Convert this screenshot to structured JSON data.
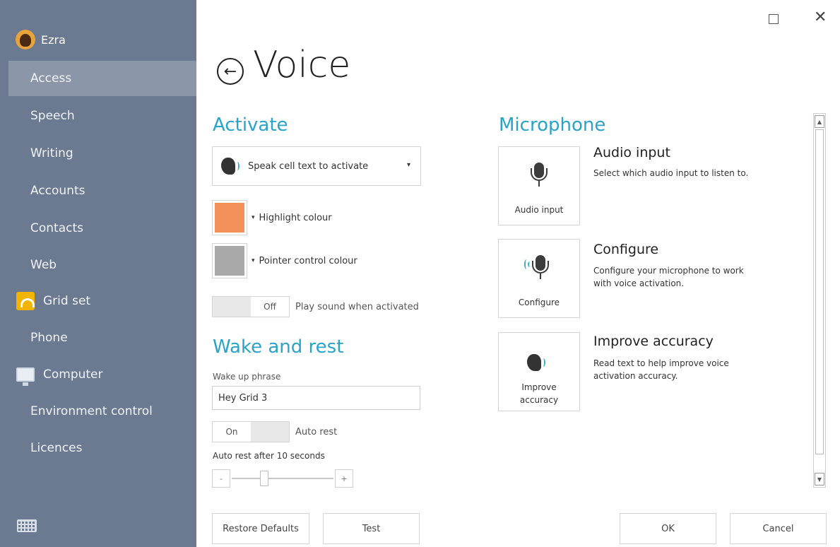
{
  "sidebar": {
    "user_name": "Ezra",
    "items": [
      {
        "label": "Access"
      },
      {
        "label": "Speech"
      },
      {
        "label": "Writing"
      },
      {
        "label": "Accounts"
      },
      {
        "label": "Contacts"
      },
      {
        "label": "Web"
      },
      {
        "label": "Grid set"
      },
      {
        "label": "Phone"
      },
      {
        "label": "Computer"
      },
      {
        "label": "Environment control"
      },
      {
        "label": "Licences"
      }
    ]
  },
  "header": {
    "title": "Voice"
  },
  "activate": {
    "title": "Activate",
    "dropdown_value": "Speak cell text to activate",
    "highlight_label": "Highlight colour",
    "highlight_color": "#f4915a",
    "pointer_label": "Pointer control colour",
    "pointer_color": "#a9a9a9",
    "sound_toggle_state": "Off",
    "sound_toggle_label": "Play sound when activated"
  },
  "wake": {
    "title": "Wake and rest",
    "phrase_label": "Wake up phrase",
    "phrase_value": "Hey Grid 3",
    "auto_rest_state": "On",
    "auto_rest_label": "Auto rest",
    "auto_rest_after_label": "Auto rest after 10 seconds",
    "slider_minus": "-",
    "slider_plus": "+"
  },
  "microphone": {
    "title": "Microphone",
    "options": [
      {
        "tile_label": "Audio input",
        "title": "Audio input",
        "desc": "Select which audio input to listen to."
      },
      {
        "tile_label": "Configure",
        "title": "Configure",
        "desc": "Configure your microphone to work with voice activation."
      },
      {
        "tile_label": "Improve accuracy",
        "title": "Improve accuracy",
        "desc": "Read text to help improve voice activation accuracy."
      }
    ]
  },
  "footer": {
    "restore_label": "Restore Defaults",
    "test_label": "Test",
    "ok_label": "OK",
    "cancel_label": "Cancel"
  }
}
